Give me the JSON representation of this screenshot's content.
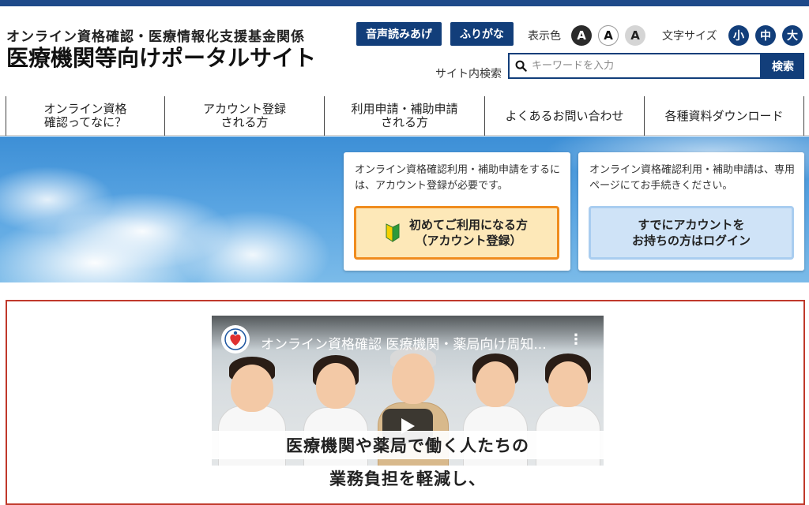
{
  "header": {
    "org_name": "オンライン資格確認・医療情報化支援基金関係",
    "site_name": "医療機関等向けポータルサイト",
    "voice_button": "音声読みあげ",
    "furigana_button": "ふりがな",
    "display_color_label": "表示色",
    "color_options": [
      "A",
      "A",
      "A"
    ],
    "font_size_label": "文字サイズ",
    "font_size_options": [
      "小",
      "中",
      "大"
    ],
    "search_label": "サイト内検索",
    "search_placeholder": "キーワードを入力",
    "search_button": "検索",
    "accent_color": "#123e7a"
  },
  "nav": {
    "items": [
      {
        "line1": "オンライン資格",
        "line2": "確認ってなに？"
      },
      {
        "line1": "アカウント登録",
        "line2": "される方"
      },
      {
        "line1": "利用申請・補助申請",
        "line2": "される方"
      },
      {
        "line1": "よくあるお問い合わせ",
        "line2": ""
      },
      {
        "line1": "各種資料ダウンロード",
        "line2": ""
      }
    ]
  },
  "hero": {
    "card1": {
      "text": "オンライン資格確認利用・補助申請をするには、アカウント登録が必要です。",
      "button_line1": "初めてご利用になる方",
      "button_line2": "（アカウント登録）",
      "icon": "beginner-mark-icon"
    },
    "card2": {
      "text": "オンライン資格確認利用・補助申請は、専用ページにてお手続きください。",
      "button_line1": "すでにアカウントを",
      "button_line2": "お持ちの方はログイン"
    }
  },
  "video": {
    "title": "オンライン資格確認 医療機関・薬局向け周知...",
    "caption1": "医療機関や薬局で働く人たちの",
    "caption2": "業務負担を軽減し、",
    "icons": [
      "channel-logo-icon",
      "more-options-icon",
      "play-icon"
    ]
  }
}
